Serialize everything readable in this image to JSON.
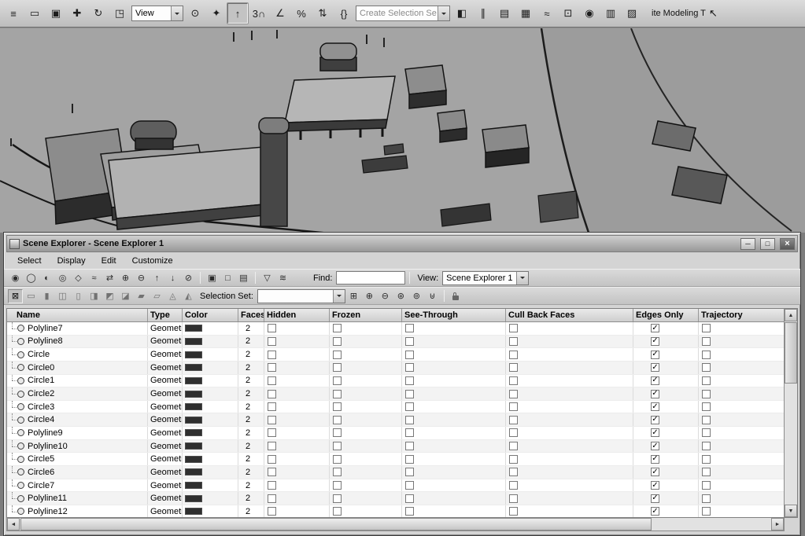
{
  "main_toolbar": {
    "view_value": "View",
    "selection_set_value": "Create Selection Se",
    "tooltip_text": "ite Modeling T",
    "cursor_glyph": "↖",
    "left_buttons": [
      {
        "name": "select-by-name",
        "glyph": "≡"
      },
      {
        "name": "rectangular-selection-region",
        "glyph": "▭"
      },
      {
        "name": "window-crossing-toggle",
        "glyph": "▣"
      },
      {
        "name": "select-and-move",
        "glyph": "✚"
      },
      {
        "name": "select-and-rotate",
        "glyph": "↻"
      },
      {
        "name": "select-and-scale",
        "glyph": "◳"
      }
    ],
    "mid_buttons": [
      {
        "name": "use-pivot-point-center",
        "glyph": "⊙"
      },
      {
        "name": "select-and-manipulate",
        "glyph": "✦"
      },
      {
        "name": "keyboard-shortcut-override",
        "glyph": "↑",
        "pressed": true
      },
      {
        "name": "snaps-toggle",
        "glyph": "3∩"
      },
      {
        "name": "angle-snap-toggle",
        "glyph": "∠"
      },
      {
        "name": "percent-snap-toggle",
        "glyph": "%"
      },
      {
        "name": "spinner-snap-toggle",
        "glyph": "⇅"
      },
      {
        "name": "edit-named-selection-sets",
        "glyph": "{}"
      }
    ],
    "right_buttons": [
      {
        "name": "mirror",
        "glyph": "◧"
      },
      {
        "name": "align",
        "glyph": "∥"
      },
      {
        "name": "layer-manager",
        "glyph": "▤"
      },
      {
        "name": "graphite-modeling-tools",
        "glyph": "▦"
      },
      {
        "name": "curve-editor",
        "glyph": "≈"
      },
      {
        "name": "schematic-view",
        "glyph": "⊡"
      },
      {
        "name": "material-editor",
        "glyph": "◉"
      },
      {
        "name": "render-setup",
        "glyph": "▥"
      },
      {
        "name": "rendered-frame-window",
        "glyph": "▨"
      }
    ]
  },
  "scrollbar": {
    "up": "▲",
    "down": "▼",
    "left": "◄",
    "right": "►"
  },
  "scene_explorer": {
    "title": "Scene Explorer - Scene Explorer 1",
    "window_controls": {
      "minimize": "─",
      "maximize": "□",
      "close": "×"
    },
    "menus": [
      "Select",
      "Display",
      "Edit",
      "Customize"
    ],
    "find_label": "Find:",
    "find_value": "",
    "view_label": "View:",
    "view_value": "Scene Explorer 1",
    "selection_set_label": "Selection Set:",
    "selection_set_value": "",
    "toolbar_icons": [
      {
        "name": "select-all",
        "glyph": "◉"
      },
      {
        "name": "select-none",
        "glyph": "◯"
      },
      {
        "name": "select-invert",
        "glyph": "◐"
      },
      {
        "name": "select-instances",
        "glyph": "◎"
      },
      {
        "name": "select-similar",
        "glyph": "◇"
      },
      {
        "name": "select-influences",
        "glyph": "≈"
      },
      {
        "name": "sync-selection",
        "glyph": "⇄"
      },
      {
        "name": "expand-selection",
        "glyph": "⊕"
      },
      {
        "name": "shrink-selection",
        "glyph": "⊖"
      },
      {
        "name": "select-parent",
        "glyph": "↑"
      },
      {
        "name": "select-children",
        "glyph": "↓"
      },
      {
        "name": "lock-selection",
        "glyph": "⊘"
      }
    ],
    "display_toggles": [
      {
        "name": "list-view-toggle",
        "glyph": "▣"
      },
      {
        "name": "hierarchy-view-toggle",
        "glyph": "□"
      },
      {
        "name": "detail-view-toggle",
        "glyph": "▤"
      }
    ],
    "filter_buttons": [
      {
        "name": "advanced-filter",
        "glyph": "▽"
      },
      {
        "name": "configure-filter",
        "glyph": "≋"
      }
    ],
    "edit_toolbar_icons": [
      {
        "name": "lock-cell-editing",
        "glyph": "⊠",
        "active": true
      },
      {
        "name": "edit-name-toggle",
        "glyph": "▭"
      },
      {
        "name": "edit-color-toggle",
        "glyph": "▮"
      },
      {
        "name": "edit-hidden-toggle",
        "glyph": "◫"
      },
      {
        "name": "edit-frozen-toggle",
        "glyph": "▯"
      },
      {
        "name": "edit-seethrough-toggle",
        "glyph": "◨"
      },
      {
        "name": "edit-renderable-toggle",
        "glyph": "◩"
      },
      {
        "name": "edit-cullback-toggle",
        "glyph": "◪"
      },
      {
        "name": "edit-edges-toggle",
        "glyph": "▰"
      },
      {
        "name": "edit-trajectory-toggle",
        "glyph": "▱"
      },
      {
        "name": "edit-visibility-toggle",
        "glyph": "◬"
      },
      {
        "name": "edit-gi-toggle",
        "glyph": "◭"
      }
    ],
    "selection_set_buttons": [
      {
        "name": "create-selection-set",
        "glyph": "⊞"
      },
      {
        "name": "add-to-selection-set",
        "glyph": "⊕"
      },
      {
        "name": "subtract-from-selection-set",
        "glyph": "⊖"
      },
      {
        "name": "select-set-members",
        "glyph": "⊛"
      },
      {
        "name": "highlight-selection-set",
        "glyph": "⊚"
      },
      {
        "name": "combine-selection-sets",
        "glyph": "⊎"
      }
    ],
    "columns": [
      "Name",
      "Type",
      "Color",
      "Faces",
      "Hidden",
      "Frozen",
      "See-Through",
      "Cull Back Faces",
      "Edges Only",
      "Trajectory"
    ],
    "rows": [
      {
        "name": "Polyline7",
        "type": "Geometry",
        "color": "#2f2f2f",
        "faces": "2",
        "hidden": false,
        "frozen": false,
        "see_through": false,
        "cull_back_faces": false,
        "edges_only": true,
        "trajectory": false
      },
      {
        "name": "Polyline8",
        "type": "Geometry",
        "color": "#2f2f2f",
        "faces": "2",
        "hidden": false,
        "frozen": false,
        "see_through": false,
        "cull_back_faces": false,
        "edges_only": true,
        "trajectory": false
      },
      {
        "name": "Circle",
        "type": "Geometry",
        "color": "#2f2f2f",
        "faces": "2",
        "hidden": false,
        "frozen": false,
        "see_through": false,
        "cull_back_faces": false,
        "edges_only": true,
        "trajectory": false
      },
      {
        "name": "Circle0",
        "type": "Geometry",
        "color": "#2f2f2f",
        "faces": "2",
        "hidden": false,
        "frozen": false,
        "see_through": false,
        "cull_back_faces": false,
        "edges_only": true,
        "trajectory": false
      },
      {
        "name": "Circle1",
        "type": "Geometry",
        "color": "#2f2f2f",
        "faces": "2",
        "hidden": false,
        "frozen": false,
        "see_through": false,
        "cull_back_faces": false,
        "edges_only": true,
        "trajectory": false
      },
      {
        "name": "Circle2",
        "type": "Geometry",
        "color": "#2f2f2f",
        "faces": "2",
        "hidden": false,
        "frozen": false,
        "see_through": false,
        "cull_back_faces": false,
        "edges_only": true,
        "trajectory": false
      },
      {
        "name": "Circle3",
        "type": "Geometry",
        "color": "#2f2f2f",
        "faces": "2",
        "hidden": false,
        "frozen": false,
        "see_through": false,
        "cull_back_faces": false,
        "edges_only": true,
        "trajectory": false
      },
      {
        "name": "Circle4",
        "type": "Geometry",
        "color": "#2f2f2f",
        "faces": "2",
        "hidden": false,
        "frozen": false,
        "see_through": false,
        "cull_back_faces": false,
        "edges_only": true,
        "trajectory": false
      },
      {
        "name": "Polyline9",
        "type": "Geometry",
        "color": "#2f2f2f",
        "faces": "2",
        "hidden": false,
        "frozen": false,
        "see_through": false,
        "cull_back_faces": false,
        "edges_only": true,
        "trajectory": false
      },
      {
        "name": "Polyline10",
        "type": "Geometry",
        "color": "#2f2f2f",
        "faces": "2",
        "hidden": false,
        "frozen": false,
        "see_through": false,
        "cull_back_faces": false,
        "edges_only": true,
        "trajectory": false
      },
      {
        "name": "Circle5",
        "type": "Geometry",
        "color": "#2f2f2f",
        "faces": "2",
        "hidden": false,
        "frozen": false,
        "see_through": false,
        "cull_back_faces": false,
        "edges_only": true,
        "trajectory": false
      },
      {
        "name": "Circle6",
        "type": "Geometry",
        "color": "#2f2f2f",
        "faces": "2",
        "hidden": false,
        "frozen": false,
        "see_through": false,
        "cull_back_faces": false,
        "edges_only": true,
        "trajectory": false
      },
      {
        "name": "Circle7",
        "type": "Geometry",
        "color": "#2f2f2f",
        "faces": "2",
        "hidden": false,
        "frozen": false,
        "see_through": false,
        "cull_back_faces": false,
        "edges_only": true,
        "trajectory": false
      },
      {
        "name": "Polyline11",
        "type": "Geometry",
        "color": "#2f2f2f",
        "faces": "2",
        "hidden": false,
        "frozen": false,
        "see_through": false,
        "cull_back_faces": false,
        "edges_only": true,
        "trajectory": false
      },
      {
        "name": "Polyline12",
        "type": "Geometry",
        "color": "#2f2f2f",
        "faces": "2",
        "hidden": false,
        "frozen": false,
        "see_through": false,
        "cull_back_faces": false,
        "edges_only": true,
        "trajectory": false
      }
    ]
  }
}
